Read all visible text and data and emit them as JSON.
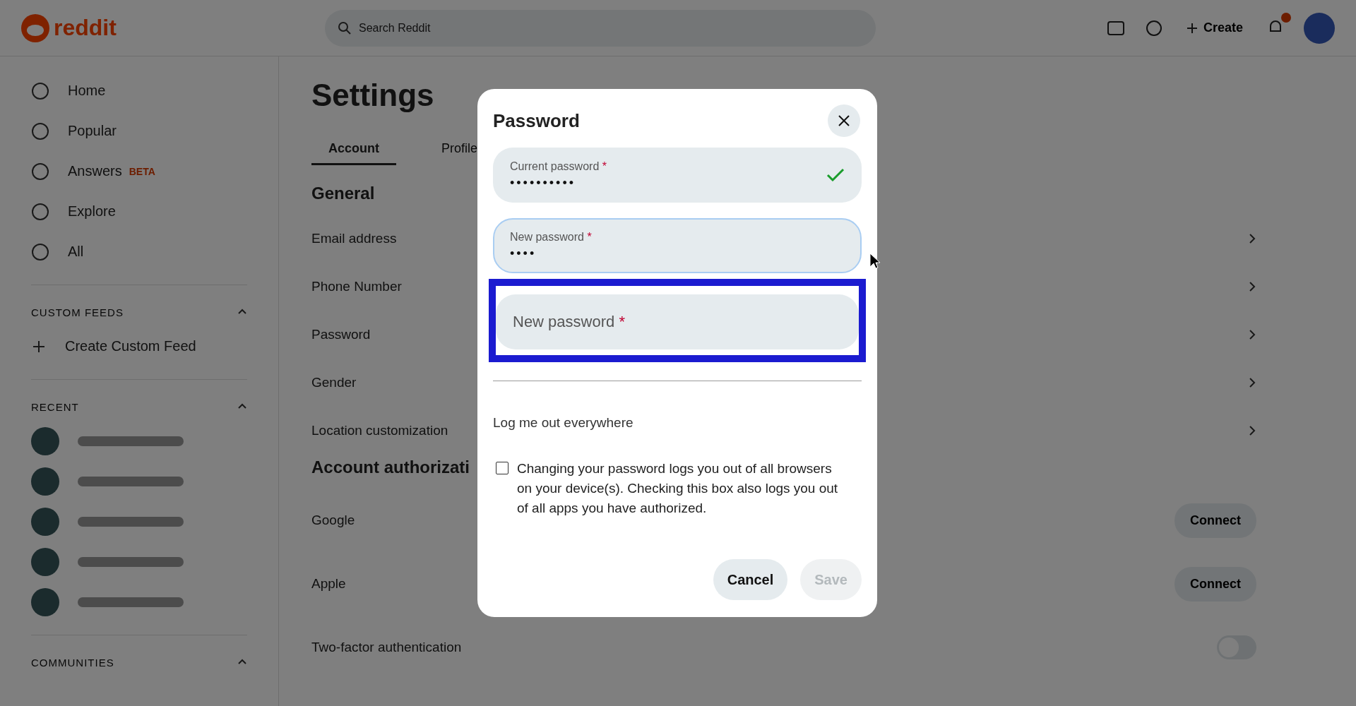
{
  "header": {
    "logo": "reddit",
    "search_placeholder": "Search Reddit",
    "create": "Create",
    "notification_badge": true
  },
  "sidebar": {
    "items": [
      {
        "label": "Home"
      },
      {
        "label": "Popular"
      },
      {
        "label": "Answers",
        "badge": "BETA"
      },
      {
        "label": "Explore"
      },
      {
        "label": "All"
      }
    ],
    "sections": [
      {
        "title": "CUSTOM FEEDS",
        "items": [
          "Create Custom Feed"
        ]
      },
      {
        "title": "RECENT",
        "communities": true
      },
      {
        "title": "COMMUNITIES"
      }
    ]
  },
  "settings": {
    "title": "Settings",
    "tabs": [
      {
        "label": "Account",
        "selected": true
      },
      {
        "label": "Profile",
        "selected": false
      }
    ],
    "sections": [
      {
        "heading": "General",
        "rows": [
          {
            "label": "Email address",
            "kind": "link"
          },
          {
            "label": "Phone Number",
            "kind": "link"
          },
          {
            "label": "Password",
            "kind": "link"
          },
          {
            "label": "Gender",
            "kind": "link"
          },
          {
            "label": "Location customization",
            "kind": "link"
          }
        ]
      },
      {
        "heading": "Account authorizati",
        "rows": [
          {
            "label": "Google",
            "kind": "connect",
            "action": "Connect"
          },
          {
            "label": "Apple",
            "kind": "connect",
            "action": "Connect"
          },
          {
            "label": "Two-factor authentication",
            "kind": "toggle",
            "on": false
          }
        ]
      }
    ]
  },
  "dialog": {
    "title": "Password",
    "fields": [
      {
        "label": "Current password",
        "required_mark": "*",
        "value": "••••••••••",
        "valid": true,
        "focused": false,
        "highlighted": false
      },
      {
        "label": "New password",
        "required_mark": "*",
        "value": "••••",
        "valid": false,
        "focused": true,
        "highlighted": false
      },
      {
        "label": "New password",
        "required_mark": "*",
        "valid": false,
        "focused": false,
        "highlighted": true
      }
    ],
    "section_title": "Log me out everywhere",
    "checkbox": {
      "label": "Changing your password logs you out of all browsers on your device(s). Checking this box also logs you out of all apps you have authorized.",
      "checked": false
    },
    "buttons": [
      {
        "label": "Cancel",
        "disabled": false
      },
      {
        "label": "Save",
        "disabled": true
      }
    ]
  }
}
